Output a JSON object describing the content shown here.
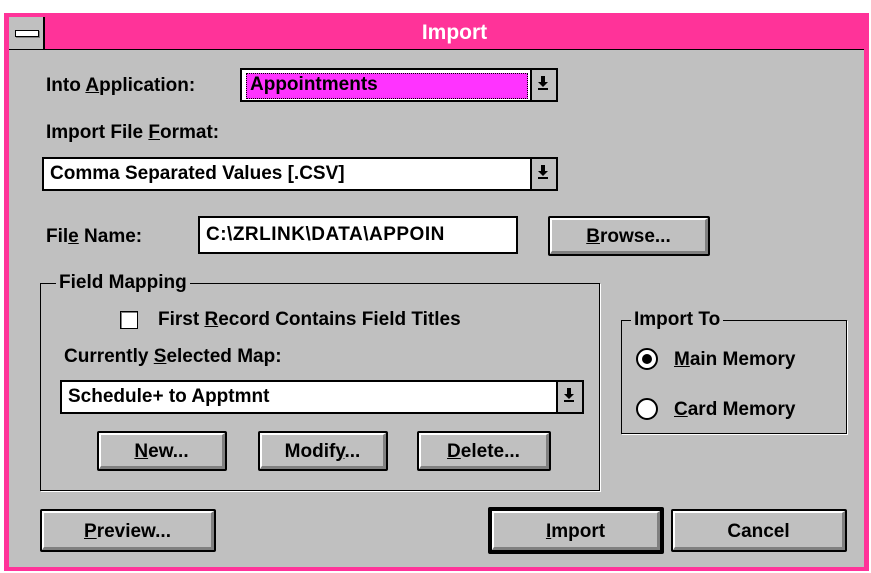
{
  "window": {
    "title": "Import"
  },
  "into_application": {
    "label_pre": "Into ",
    "label_key": "A",
    "label_post": "pplication:",
    "value": "Appointments"
  },
  "import_file_format": {
    "label_pre": "Import File ",
    "label_key": "F",
    "label_post": "ormat:",
    "value": "Comma Separated Values [.CSV]"
  },
  "file_name": {
    "label_pre": "Fil",
    "label_key": "e",
    "label_post": " Name:",
    "value": "C:\\ZRLINK\\DATA\\APPOIN"
  },
  "browse_button": {
    "key": "B",
    "rest": "rowse..."
  },
  "field_mapping": {
    "legend": "Field Mapping",
    "checkbox_pre": "First ",
    "checkbox_key": "R",
    "checkbox_post": "ecord Contains Field Titles",
    "map_label_pre": "Currently ",
    "map_label_key": "S",
    "map_label_post": "elected Map:",
    "map_value": "Schedule+ to Apptmnt",
    "new_key": "N",
    "new_rest": "ew...",
    "modify_pre": "Modif",
    "modify_key": "y",
    "modify_post": "...",
    "delete_key": "D",
    "delete_rest": "elete..."
  },
  "import_to": {
    "legend": "Import To",
    "main_key": "M",
    "main_rest": "ain Memory",
    "card_key": "C",
    "card_rest": "ard Memory"
  },
  "footer": {
    "preview_key": "P",
    "preview_rest": "review...",
    "import_key": "I",
    "import_rest": "mport",
    "cancel": "Cancel"
  },
  "colors": {
    "titlebar": "#ff3399",
    "selection": "#ff33ff",
    "face": "#c0c0c0"
  }
}
